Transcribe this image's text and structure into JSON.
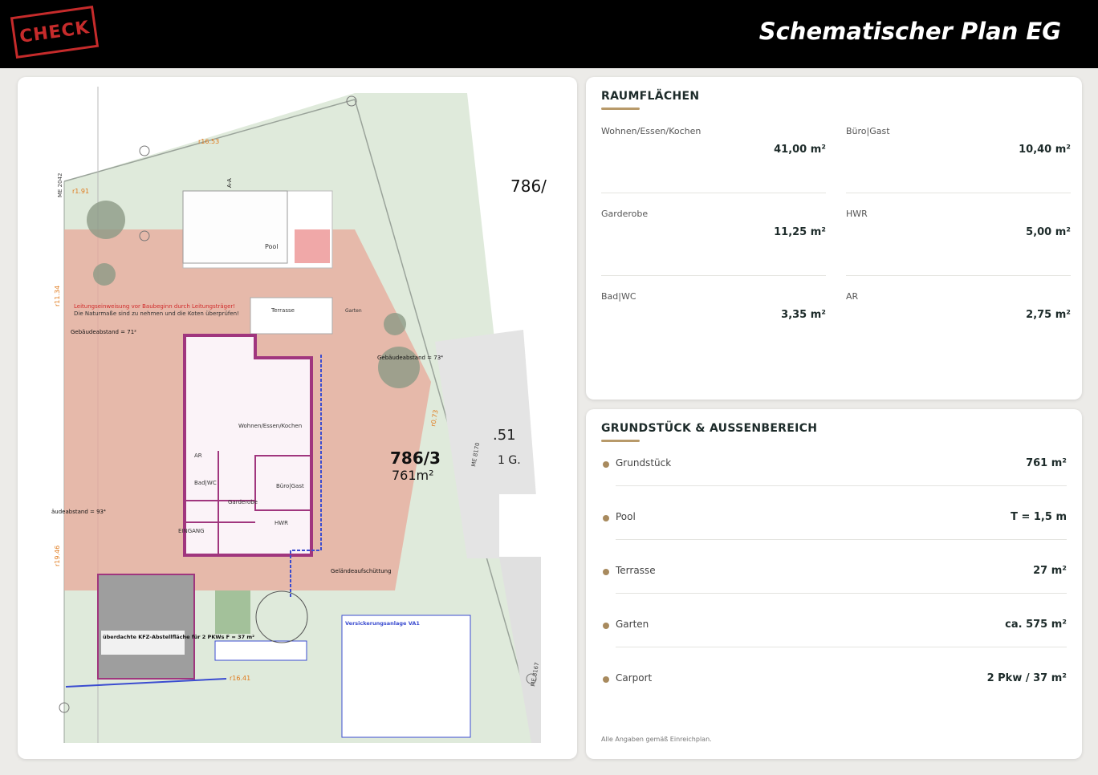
{
  "header": {
    "stamp_text": "CHECK",
    "title": "Schematischer Plan EG"
  },
  "plan": {
    "labels": {
      "parcel": "786/3",
      "parcel_area": "761m²",
      "neighbor_parcel": "786/",
      "neighbor_code": ".51",
      "neighbor_floor": "1 G.",
      "living": "Wohnen/Essen/Kochen",
      "pool": "Pool",
      "terrasse": "Terrasse",
      "garten": "Garten",
      "buero": "Büro|Gast",
      "garderobe": "Garderobe",
      "hwr": "HWR",
      "ar": "AR",
      "bad": "Bad|WC",
      "eingang": "EINGANG",
      "carport": "überdachte KFZ-Abstellfläche für 2 PKWs F = 37 m²",
      "building_distance_left": "Gebäudeabstand = 71²",
      "building_distance_right": "Gebäudeabstand = 73⁴",
      "building_distance_bottom": "äudeabstand = 93⁴",
      "gelaende": "Geländeaufschüttung",
      "warning": "Leitungseinweisung vor Baubeginn durch Leitungsträger!",
      "warning2": "Die Naturmaße sind zu nehmen und die Koten überprüfen!",
      "versickerung": "Versickerungsanlage VA1",
      "me1": "ME 2042",
      "me2": "ME 8170",
      "me3": "ME 8167",
      "dim1": "r16.53",
      "dim2": "r1.91",
      "dim3": "r11.34",
      "dim4": "r19.46",
      "dim5": "r16.41",
      "dim6": "r0.73",
      "section": "A-A"
    }
  },
  "raumflaechen": {
    "title": "RAUMFLÄCHEN",
    "rooms": [
      {
        "label": "Wohnen/Essen/Kochen",
        "value": "41,00 m²"
      },
      {
        "label": "Büro|Gast",
        "value": "10,40 m²"
      },
      {
        "label": "Garderobe",
        "value": "11,25 m²"
      },
      {
        "label": "HWR",
        "value": "5,00 m²"
      },
      {
        "label": "Bad|WC",
        "value": "3,35 m²"
      },
      {
        "label": "AR",
        "value": "2,75 m²"
      }
    ]
  },
  "aussen": {
    "title": "GRUNDSTÜCK & AUSSENBEREICH",
    "rows": [
      {
        "label": "Grundstück",
        "value": "761 m²"
      },
      {
        "label": "Pool",
        "value": "T = 1,5 m"
      },
      {
        "label": "Terrasse",
        "value": "27 m²"
      },
      {
        "label": "Garten",
        "value": "ca. 575 m²"
      },
      {
        "label": "Carport",
        "value": "2 Pkw / 37 m²"
      }
    ],
    "footnote": "Alle Angaben gemäß Einreichplan."
  },
  "colors": {
    "accent": "#b89a6a",
    "dot": "#a88a5e",
    "stamp": "#c62b2b"
  }
}
